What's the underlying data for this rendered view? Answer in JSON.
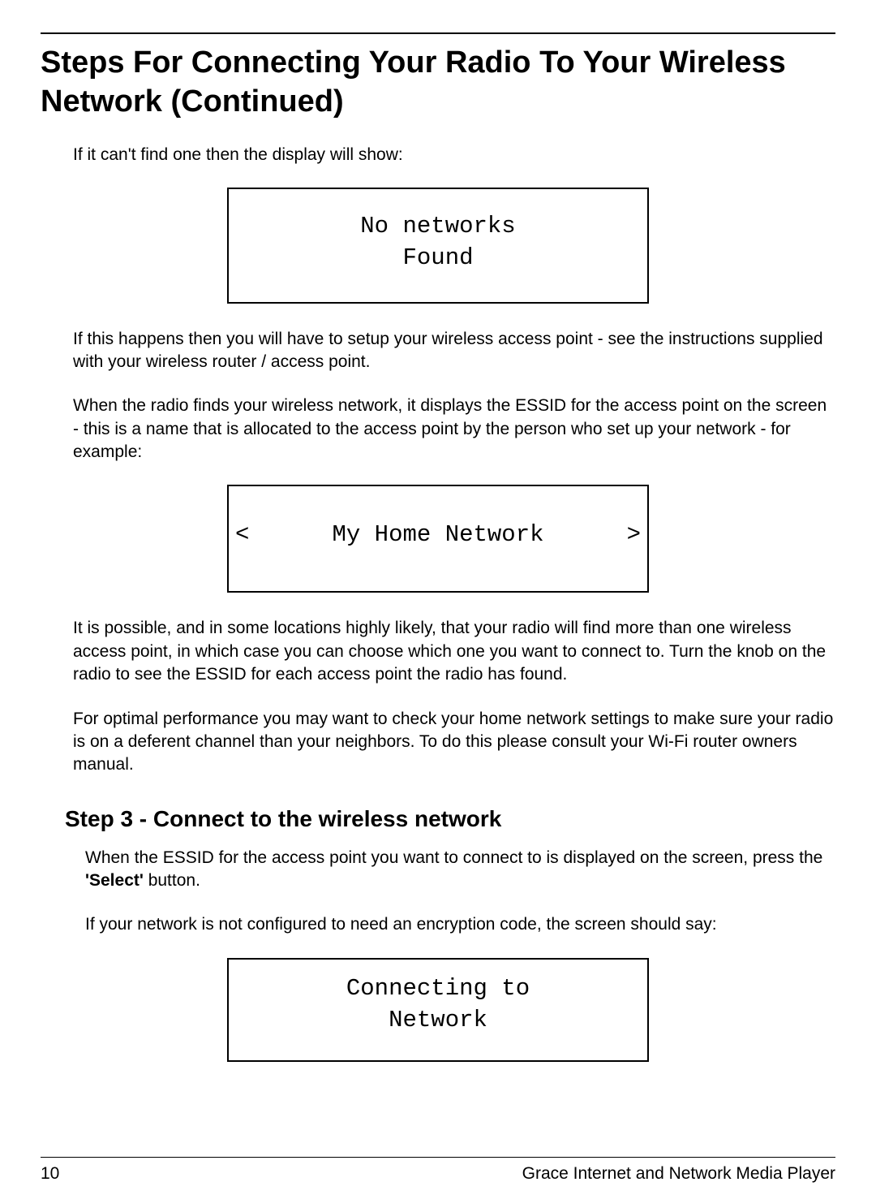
{
  "title": "Steps For Connecting Your Radio To Your Wireless Network (Continued)",
  "para1": "If it can't find one then the display will show:",
  "display1_line1": "No networks",
  "display1_line2": "Found",
  "para2": "If this happens then you will have to setup your wireless access point - see the instructions supplied with your wireless router / access point.",
  "para3": "When the radio finds your wireless network, it displays the ESSID for the access point on the screen - this is a name that is allocated to the access point by the person who set up your network - for example:",
  "display2_left": "<",
  "display2_text": "My Home Network",
  "display2_right": ">",
  "para4": "It is possible, and in some locations highly likely, that your radio will find more than one wireless access point, in which case you can choose which one you want to connect to. Turn the knob on the radio to see the ESSID for each access point the radio has found.",
  "para5": "For optimal performance you may want to check your home network settings to make sure your radio is on a deferent channel than your neighbors. To do this please consult your Wi-Fi router owners manual.",
  "step_heading": "Step 3 - Connect to the wireless network",
  "para6_a": "When the ESSID for the access point you want to connect to is displayed on the screen, press the ",
  "para6_bold": "'Select'",
  "para6_b": " button.",
  "para7": "If your network is not configured to need an encryption code, the screen should say:",
  "display3_line1": "Connecting to",
  "display3_line2": "Network",
  "footer_page": "10",
  "footer_text": "Grace Internet and Network Media Player"
}
